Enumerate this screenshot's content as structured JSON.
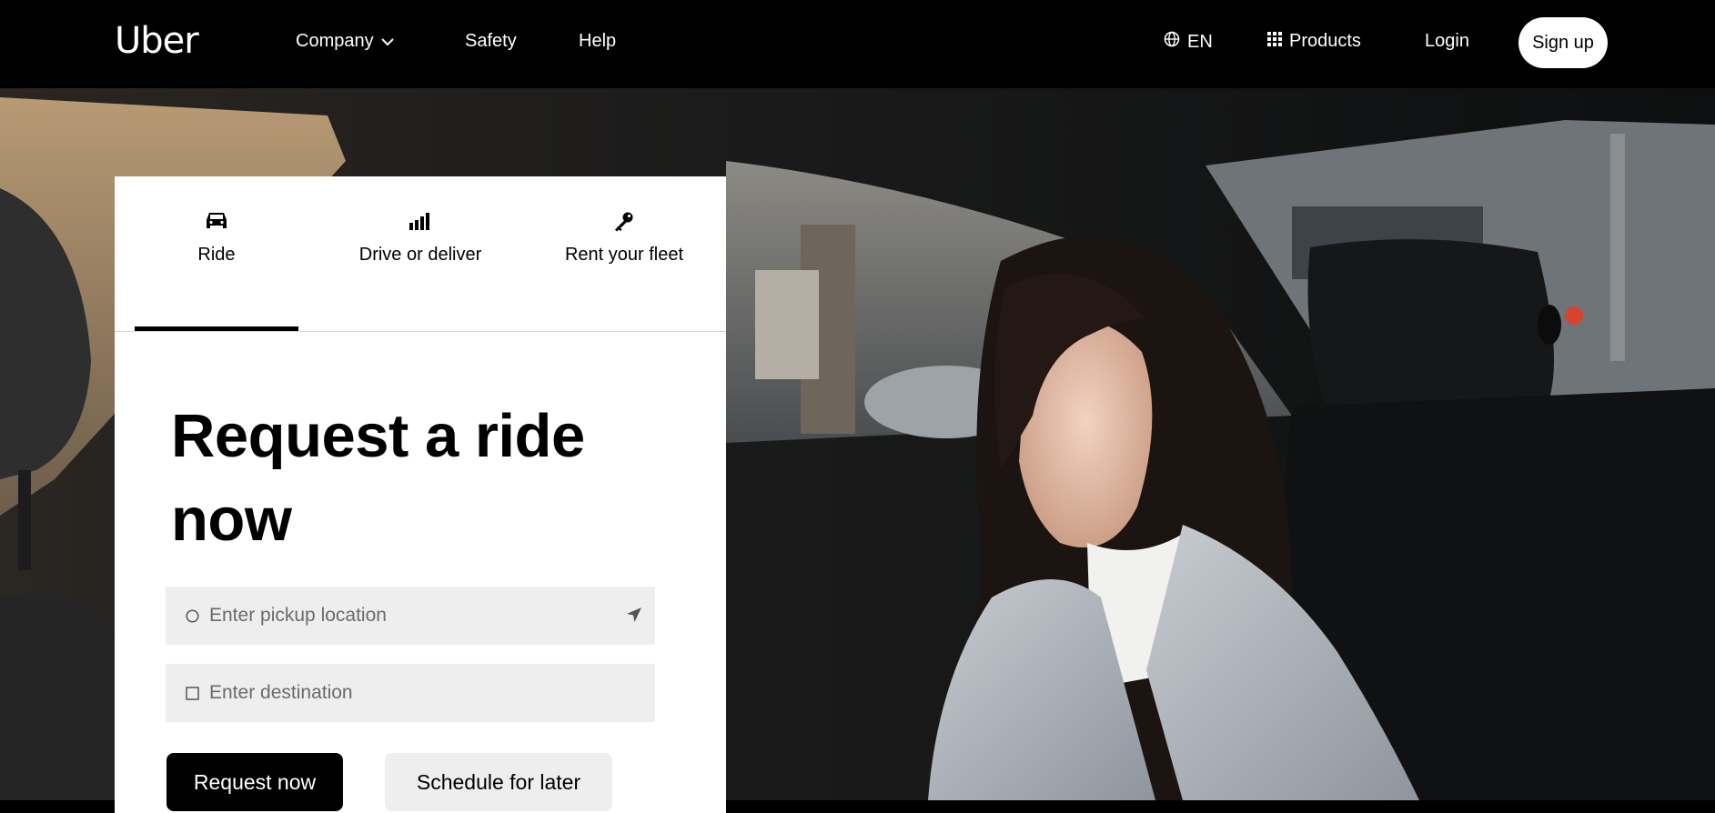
{
  "brand": {
    "logo_text": "Uber"
  },
  "nav": {
    "company_label": "Company",
    "safety_label": "Safety",
    "help_label": "Help",
    "language_label": "EN",
    "products_label": "Products",
    "login_label": "Login",
    "signup_label": "Sign up"
  },
  "icons": {
    "company_dropdown": "chevron-down-icon",
    "language": "globe-icon",
    "products": "grid-icon",
    "tab_ride": "car-icon",
    "tab_drive": "signal-bars-icon",
    "tab_rent": "key-icon",
    "pickup_lead": "circle-icon",
    "pickup_locate": "location-arrow-icon",
    "destination_lead": "square-icon"
  },
  "ride_card": {
    "tabs": [
      {
        "label": "Ride",
        "active": true
      },
      {
        "label": "Drive or deliver",
        "active": false
      },
      {
        "label": "Rent your fleet",
        "active": false
      }
    ],
    "title": "Request a ride now",
    "pickup": {
      "placeholder": "Enter pickup location",
      "value": ""
    },
    "destination": {
      "placeholder": "Enter destination",
      "value": ""
    },
    "request_button_label": "Request now",
    "schedule_button_label": "Schedule for later"
  },
  "colors": {
    "nav_background": "#000000",
    "card_background": "#ffffff",
    "input_background": "#eeeeee",
    "primary_button": "#000000",
    "secondary_button": "#eeeeee"
  }
}
